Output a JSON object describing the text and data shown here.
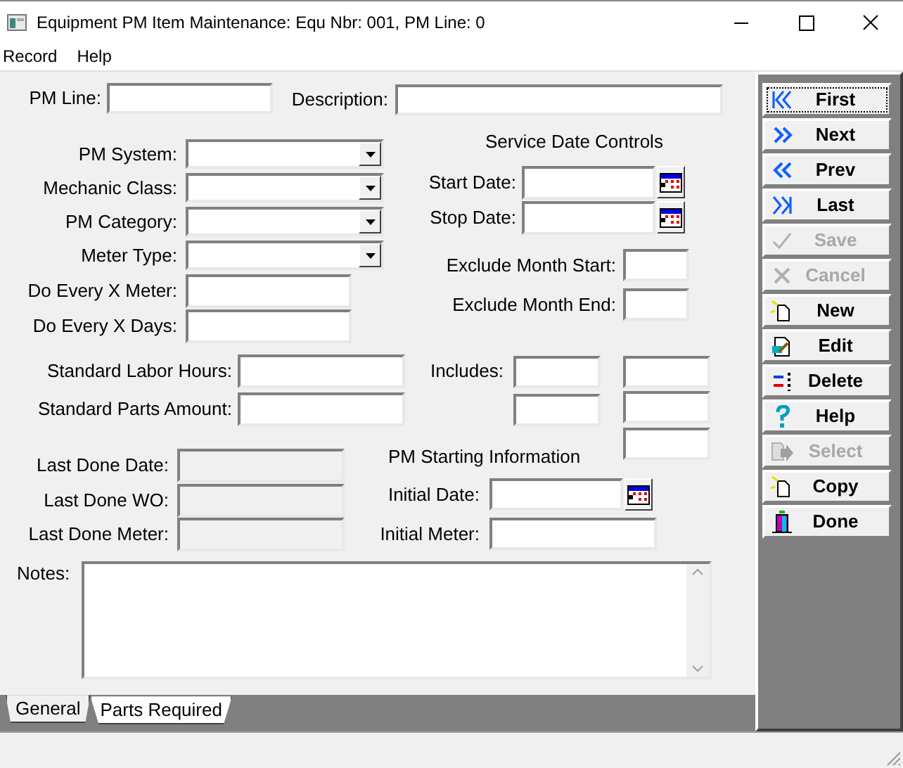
{
  "window": {
    "title": "Equipment PM Item Maintenance: Equ Nbr: 001, PM Line: 0"
  },
  "menu": [
    "Record",
    "Help"
  ],
  "form": {
    "headings": [
      "Service Date Controls",
      "PM Starting Information"
    ],
    "fields": [
      {
        "kind": "text",
        "label": "PM Line:"
      },
      {
        "kind": "text",
        "label": "Description:"
      },
      {
        "kind": "combo",
        "label": "PM System:"
      },
      {
        "kind": "combo",
        "label": "Mechanic Class:"
      },
      {
        "kind": "combo",
        "label": "PM Category:"
      },
      {
        "kind": "combo",
        "label": "Meter Type:"
      },
      {
        "kind": "text",
        "label": "Do Every X Meter:"
      },
      {
        "kind": "text",
        "label": "Do Every X Days:"
      },
      {
        "kind": "date",
        "label": "Start Date:"
      },
      {
        "kind": "date",
        "label": "Stop Date:"
      },
      {
        "kind": "text",
        "label": "Exclude Month Start:"
      },
      {
        "kind": "text",
        "label": "Exclude Month End:"
      },
      {
        "kind": "text",
        "label": "Standard Labor Hours:"
      },
      {
        "kind": "text",
        "label": "Standard Parts Amount:"
      },
      {
        "kind": "includes",
        "label": "Includes:"
      },
      {
        "kind": "readonly",
        "label": "Last Done Date:"
      },
      {
        "kind": "readonly",
        "label": "Last Done WO:"
      },
      {
        "kind": "readonly",
        "label": "Last Done Meter:"
      },
      {
        "kind": "date",
        "label": "Initial Date:"
      },
      {
        "kind": "text",
        "label": "Initial Meter:"
      }
    ],
    "notes": {
      "label": "Notes:"
    }
  },
  "tabs": [
    {
      "label": "General",
      "selected": true
    },
    {
      "label": "Parts Required",
      "selected": false
    }
  ],
  "buttons": [
    {
      "label": "First",
      "disabled": false,
      "focused": true
    },
    {
      "label": "Next",
      "disabled": false,
      "focused": false
    },
    {
      "label": "Prev",
      "disabled": false,
      "focused": false
    },
    {
      "label": "Last",
      "disabled": false,
      "focused": false
    },
    {
      "label": "Save",
      "disabled": true,
      "focused": false
    },
    {
      "label": "Cancel",
      "disabled": true,
      "focused": false
    },
    {
      "label": "New",
      "disabled": false,
      "focused": false
    },
    {
      "label": "Edit",
      "disabled": false,
      "focused": false
    },
    {
      "label": "Delete",
      "disabled": false,
      "focused": false
    },
    {
      "label": "Help",
      "disabled": false,
      "focused": false
    },
    {
      "label": "Select",
      "disabled": true,
      "focused": false
    },
    {
      "label": "Copy",
      "disabled": false,
      "focused": false
    },
    {
      "label": "Done",
      "disabled": false,
      "focused": false
    }
  ]
}
